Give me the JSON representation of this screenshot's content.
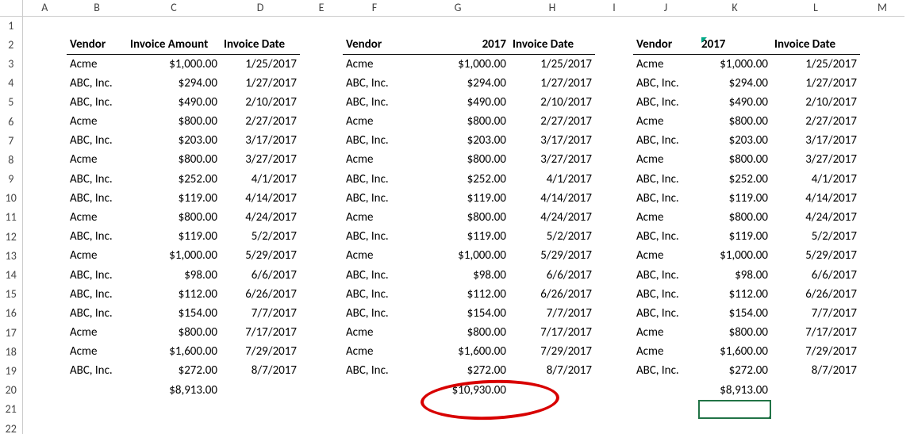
{
  "columns": [
    "A",
    "B",
    "C",
    "D",
    "E",
    "F",
    "G",
    "H",
    "I",
    "J",
    "K",
    "L",
    "M"
  ],
  "rows": [
    "1",
    "2",
    "3",
    "4",
    "5",
    "6",
    "7",
    "8",
    "9",
    "10",
    "11",
    "12",
    "13",
    "14",
    "15",
    "16",
    "17",
    "18",
    "19",
    "20",
    "21",
    "22"
  ],
  "headers": {
    "block1": {
      "vendor": "Vendor",
      "amount": "Invoice Amount",
      "date": "Invoice Date"
    },
    "block2": {
      "vendor": "Vendor",
      "amount": "2017",
      "date": "Invoice Date"
    },
    "block3": {
      "vendor": "Vendor",
      "amount": "2017",
      "date": "Invoice Date"
    }
  },
  "data": [
    {
      "vendor": "Acme",
      "amount": "$1,000.00",
      "date": "1/25/2017"
    },
    {
      "vendor": "ABC, Inc.",
      "amount": "$294.00",
      "date": "1/27/2017"
    },
    {
      "vendor": "ABC, Inc.",
      "amount": "$490.00",
      "date": "2/10/2017"
    },
    {
      "vendor": "Acme",
      "amount": "$800.00",
      "date": "2/27/2017"
    },
    {
      "vendor": "ABC, Inc.",
      "amount": "$203.00",
      "date": "3/17/2017"
    },
    {
      "vendor": "Acme",
      "amount": "$800.00",
      "date": "3/27/2017"
    },
    {
      "vendor": "ABC, Inc.",
      "amount": "$252.00",
      "date": "4/1/2017"
    },
    {
      "vendor": "ABC, Inc.",
      "amount": "$119.00",
      "date": "4/14/2017"
    },
    {
      "vendor": "Acme",
      "amount": "$800.00",
      "date": "4/24/2017"
    },
    {
      "vendor": "ABC, Inc.",
      "amount": "$119.00",
      "date": "5/2/2017"
    },
    {
      "vendor": "Acme",
      "amount": "$1,000.00",
      "date": "5/29/2017"
    },
    {
      "vendor": "ABC, Inc.",
      "amount": "$98.00",
      "date": "6/6/2017"
    },
    {
      "vendor": "ABC, Inc.",
      "amount": "$112.00",
      "date": "6/26/2017"
    },
    {
      "vendor": "ABC, Inc.",
      "amount": "$154.00",
      "date": "7/7/2017"
    },
    {
      "vendor": "Acme",
      "amount": "$800.00",
      "date": "7/17/2017"
    },
    {
      "vendor": "Acme",
      "amount": "$1,600.00",
      "date": "7/29/2017"
    },
    {
      "vendor": "ABC, Inc.",
      "amount": "$272.00",
      "date": "8/7/2017"
    }
  ],
  "totals": {
    "block1": "$8,913.00",
    "block2": "$10,930.00",
    "block3": "$8,913.00"
  },
  "chart_data": {
    "type": "table",
    "title": "Invoice data — three copies with differing sum in middle block",
    "columns": [
      "Vendor",
      "Invoice Amount",
      "Invoice Date"
    ],
    "rows": [
      [
        "Acme",
        1000.0,
        "1/25/2017"
      ],
      [
        "ABC, Inc.",
        294.0,
        "1/27/2017"
      ],
      [
        "ABC, Inc.",
        490.0,
        "2/10/2017"
      ],
      [
        "Acme",
        800.0,
        "2/27/2017"
      ],
      [
        "ABC, Inc.",
        203.0,
        "3/17/2017"
      ],
      [
        "Acme",
        800.0,
        "3/27/2017"
      ],
      [
        "ABC, Inc.",
        252.0,
        "4/1/2017"
      ],
      [
        "ABC, Inc.",
        119.0,
        "4/14/2017"
      ],
      [
        "Acme",
        800.0,
        "4/24/2017"
      ],
      [
        "ABC, Inc.",
        119.0,
        "5/2/2017"
      ],
      [
        "Acme",
        1000.0,
        "5/29/2017"
      ],
      [
        "ABC, Inc.",
        98.0,
        "6/6/2017"
      ],
      [
        "ABC, Inc.",
        112.0,
        "6/26/2017"
      ],
      [
        "ABC, Inc.",
        154.0,
        "7/7/2017"
      ],
      [
        "Acme",
        800.0,
        "7/17/2017"
      ],
      [
        "Acme",
        1600.0,
        "7/29/2017"
      ],
      [
        "ABC, Inc.",
        272.0,
        "8/7/2017"
      ]
    ],
    "totals": {
      "block1": 8913.0,
      "block2": 10930.0,
      "block3": 8913.0
    },
    "highlight": "block2 total"
  }
}
